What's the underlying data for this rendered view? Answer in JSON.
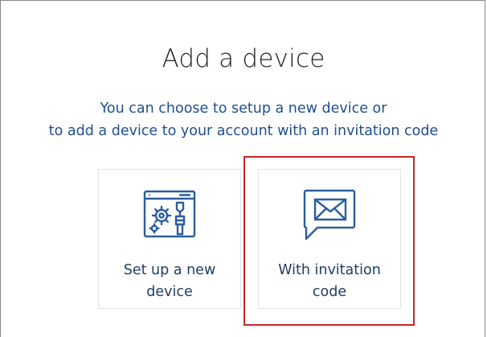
{
  "dialog": {
    "title": "Add a device",
    "subtitle_line1": "You can choose to setup a new device or",
    "subtitle_line2": "to add a device to your account with an invitation code"
  },
  "options": [
    {
      "id": "setup",
      "icon": "gear-window-icon",
      "label_line1": "Set up a new",
      "label_line2": "device"
    },
    {
      "id": "invite",
      "icon": "envelope-message-icon",
      "label_line1": "With invitation",
      "label_line2": "code"
    }
  ],
  "colors": {
    "accent": "#1f4f8f",
    "icon": "#2a5d9f",
    "highlight": "#c8252c"
  }
}
